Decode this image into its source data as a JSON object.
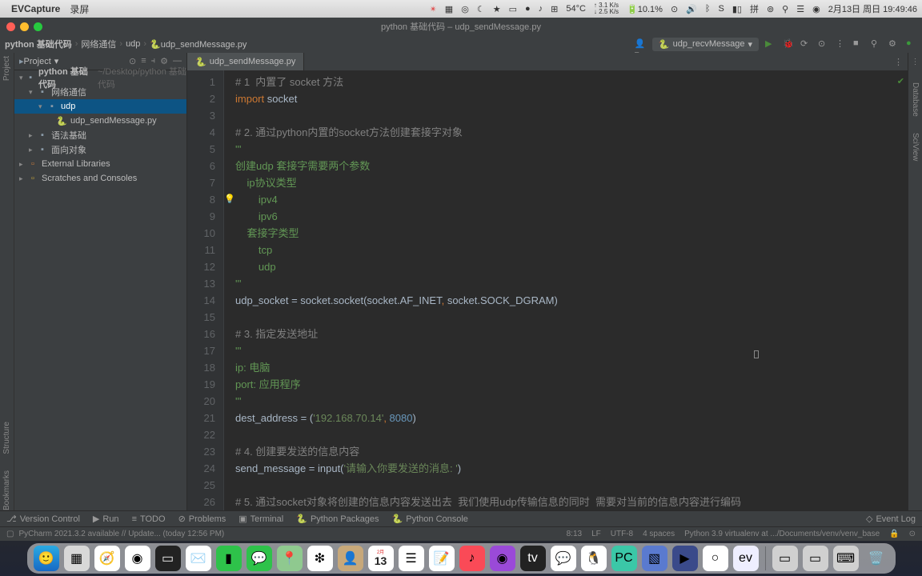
{
  "menubar": {
    "app": "EVCapture",
    "items": [
      "录屏"
    ],
    "temp": "54°C",
    "net": "↑ 3.1 K/s\n↓ 2.5 K/s",
    "battery": "10.1%",
    "date": "2月13日 周日 19:49:46"
  },
  "titlebar": {
    "title": "python 基础代码 – udp_sendMessage.py"
  },
  "breadcrumbs": [
    "python 基础代码",
    "网络通信",
    "udp",
    "udp_sendMessage.py"
  ],
  "run_config": "udp_recvMessage",
  "project_panel": {
    "title": "Project"
  },
  "tree": {
    "root": {
      "label": "python 基础代码",
      "hint": "~/Desktop/python 基础代码"
    },
    "net": "网络通信",
    "udp": "udp",
    "file": "udp_sendMessage.py",
    "grammar": "语法基础",
    "oop": "面向对象",
    "extlib": "External Libraries",
    "scratch": "Scratches and Consoles"
  },
  "sidestrip": {
    "project": "Project",
    "structure": "Structure",
    "bookmarks": "Bookmarks",
    "database": "Database",
    "sciview": "SciView"
  },
  "tab": {
    "name": "udp_sendMessage.py"
  },
  "code": {
    "l1": "# 1  内置了 socket 方法",
    "l2a": "import",
    "l2b": " socket",
    "l4": "# 2. 通过python内置的socket方法创建套接字对象",
    "l5": "'''",
    "l6": "创建udp 套接字需要两个参数",
    "l7": "    ip协议类型",
    "l8": "        ipv4",
    "l9": "        ipv6",
    "l10": "    套接字类型",
    "l11": "        tcp",
    "l12": "        udp",
    "l13": "'''",
    "l14a": "udp_socket = socket.socket(socket.AF_INET",
    "l14b": ",",
    "l14c": " socket.SOCK_DGRAM)",
    "l16": "# 3. 指定发送地址",
    "l17": "'''",
    "l18": "ip: 电脑",
    "l19": "port: 应用程序",
    "l20": "'''",
    "l21a": "dest_address = (",
    "l21b": "'192.168.70.14'",
    "l21c": ",",
    "l21d": " 8080",
    "l21e": ")",
    "l23": "# 4. 创建要发送的信息内容",
    "l24a": "send_message = input(",
    "l24b": "'请输入你要发送的消息: '",
    "l24c": ")",
    "l26": "# 5. 通过socket对象将创建的信息内容发送出去  我们使用udp传输信息的同时  需要对当前的信息内容进行编码"
  },
  "line_numbers": [
    "1",
    "2",
    "3",
    "4",
    "5",
    "6",
    "7",
    "8",
    "9",
    "10",
    "11",
    "12",
    "13",
    "14",
    "15",
    "16",
    "17",
    "18",
    "19",
    "20",
    "21",
    "22",
    "23",
    "24",
    "25",
    "26"
  ],
  "toolwindows": {
    "vcs": "Version Control",
    "run": "Run",
    "todo": "TODO",
    "problems": "Problems",
    "terminal": "Terminal",
    "pypkg": "Python Packages",
    "pyconsole": "Python Console",
    "eventlog": "Event Log"
  },
  "statusbar": {
    "update": "PyCharm 2021.3.2 available // Update... (today 12:56 PM)",
    "pos": "8:13",
    "le": "LF",
    "enc": "UTF-8",
    "indent": "4 spaces",
    "interp": "Python 3.9 virtualenv at .../Documents/venv/venv_base"
  },
  "dock": {
    "cal_month": "2月",
    "cal_day": "13"
  }
}
